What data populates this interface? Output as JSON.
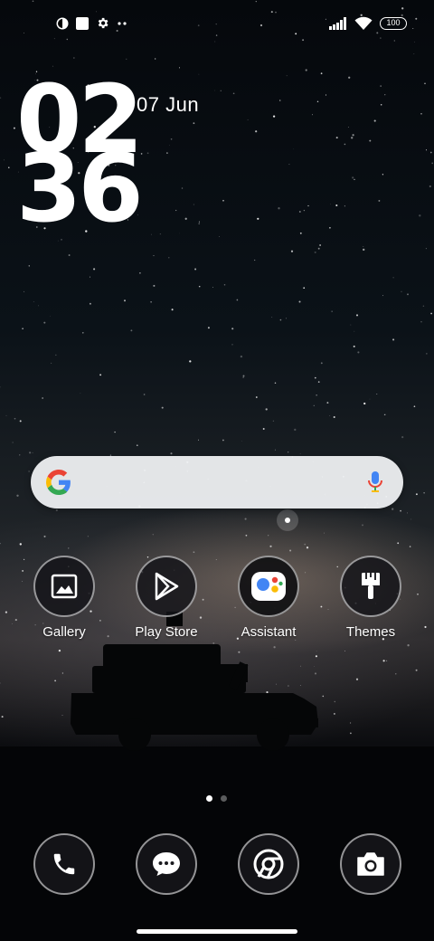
{
  "status_bar": {
    "left_icons": [
      "notification-icon",
      "square-notification-icon",
      "settings-gear-icon",
      "more-dots-icon"
    ],
    "right_icons": [
      "signal-bars-icon",
      "wifi-icon",
      "battery-icon"
    ],
    "battery_level": "100"
  },
  "clock_widget": {
    "hours": "02",
    "minutes": "36",
    "date": "07 Jun"
  },
  "search_widget": {
    "logo": "google-g-icon",
    "mic": "microphone-icon"
  },
  "home_apps": [
    {
      "label": "Gallery",
      "icon": "gallery-image-icon"
    },
    {
      "label": "Play Store",
      "icon": "play-store-icon"
    },
    {
      "label": "Assistant",
      "icon": "assistant-icon"
    },
    {
      "label": "Themes",
      "icon": "paintbrush-icon"
    }
  ],
  "pager": {
    "pages": 2,
    "current": 1
  },
  "dock_apps": [
    {
      "icon": "phone-icon"
    },
    {
      "icon": "messages-icon"
    },
    {
      "icon": "chrome-icon"
    },
    {
      "icon": "camera-icon"
    }
  ],
  "colors": {
    "google_blue": "#4285F4",
    "google_red": "#EA4335",
    "google_yellow": "#FBBC05",
    "google_green": "#34A853"
  }
}
